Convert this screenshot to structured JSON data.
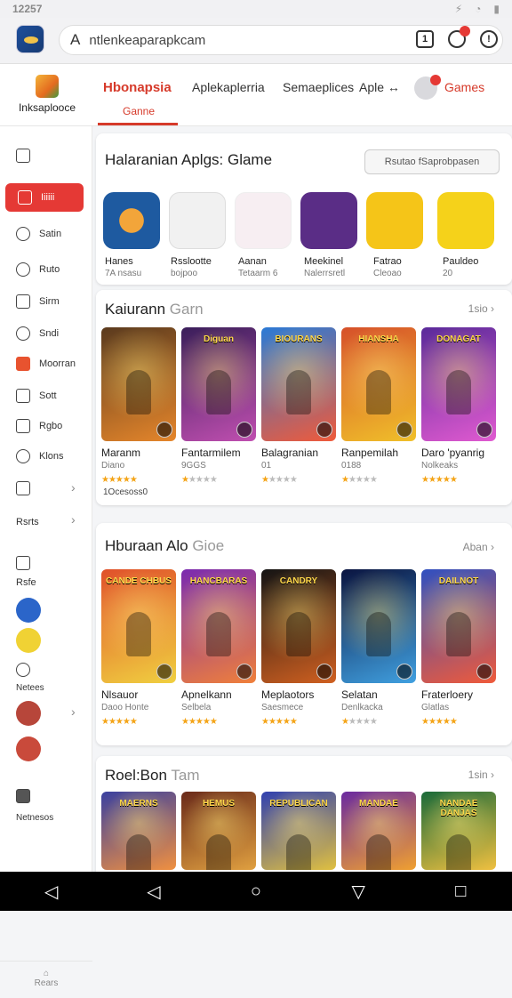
{
  "status": {
    "time": "12257",
    "alert": "⚡"
  },
  "browser": {
    "url": "ntlenkeaparapkcam",
    "tab_count": "1"
  },
  "brand": {
    "label": "Inksaplooce"
  },
  "nav": {
    "tabs": [
      "Hbonapsia",
      "Aplekaplerria",
      "Semaeplices",
      "Aple ↔",
      "Games"
    ],
    "active_sub": "Ganne"
  },
  "sidebar": {
    "active": "Iiiiii",
    "items": [
      "Satin",
      "Ruto",
      "Sirm",
      "Sndi",
      "Moorran",
      "Sott",
      "Rgbo",
      "Klons"
    ],
    "more": "Rsrts",
    "extras": [
      "Rsfe",
      "Netees",
      "Netnesos"
    ],
    "bottom": "Rears"
  },
  "featured": {
    "title": "Halaranian Aplgs: Glame",
    "button": "Rsutao fSaprobpasen",
    "apps": [
      {
        "name": "Hanes",
        "sub": "7A nsasu"
      },
      {
        "name": "Rsslootte",
        "sub": "bojpoo"
      },
      {
        "name": "Aanan",
        "sub": "Tetaarm 6"
      },
      {
        "name": "Meekinel",
        "sub": "Nalerrsretl"
      },
      {
        "name": "Fatrao",
        "sub": "Cleoao"
      },
      {
        "name": "Pauldeo",
        "sub": "20"
      }
    ]
  },
  "sections": [
    {
      "title": "Kaiurann",
      "title_muted": "Garn",
      "link": "1sio",
      "games": [
        {
          "name": "Maranm",
          "sub": "Diano",
          "rating": 4.5,
          "art": ""
        },
        {
          "name": "Fantarmilem",
          "sub": "9GGS",
          "rating": 0.5,
          "art": "Diguan"
        },
        {
          "name": "Balagranian",
          "sub": "01",
          "rating": 0.5,
          "art": "BIOURANS"
        },
        {
          "name": "Ranpemilah",
          "sub": "0188",
          "rating": 1,
          "art": "HIANSHA"
        },
        {
          "name": "Daro 'pyanrig",
          "sub": "Nolkeaks",
          "rating": 4.5,
          "art": "DONAGAT"
        }
      ],
      "extra": "1Ocesoss0"
    },
    {
      "title": "Hburaan Alo",
      "title_muted": "Gioe",
      "link": "Aban",
      "games": [
        {
          "name": "Nlsauor",
          "sub": "Daoo Honte",
          "rating": 4.5,
          "art": "CANDE CHBUS"
        },
        {
          "name": "Apnelkann",
          "sub": "Selbela",
          "rating": 4.5,
          "art": "HANCBARAS"
        },
        {
          "name": "Meplaotors",
          "sub": "Saesmece",
          "rating": 5,
          "art": "CANDRY"
        },
        {
          "name": "Selatan",
          "sub": "Denlkacka",
          "rating": 1,
          "art": ""
        },
        {
          "name": "Fraterloery",
          "sub": "Glatlas",
          "rating": 4.5,
          "art": "DAILNOT"
        }
      ]
    },
    {
      "title": "Roel:Bon",
      "title_muted": "Tam",
      "link": "1sin",
      "games": [
        {
          "art": "MAERNS"
        },
        {
          "art": "HEMUS"
        },
        {
          "art": "REPUBLICAN"
        },
        {
          "art": "MANDAE"
        },
        {
          "art": "NANDAE DANJAS"
        }
      ]
    }
  ],
  "colors": {
    "accent": "#e53935",
    "star": "#f4a417",
    "link": "#d63a2a"
  }
}
